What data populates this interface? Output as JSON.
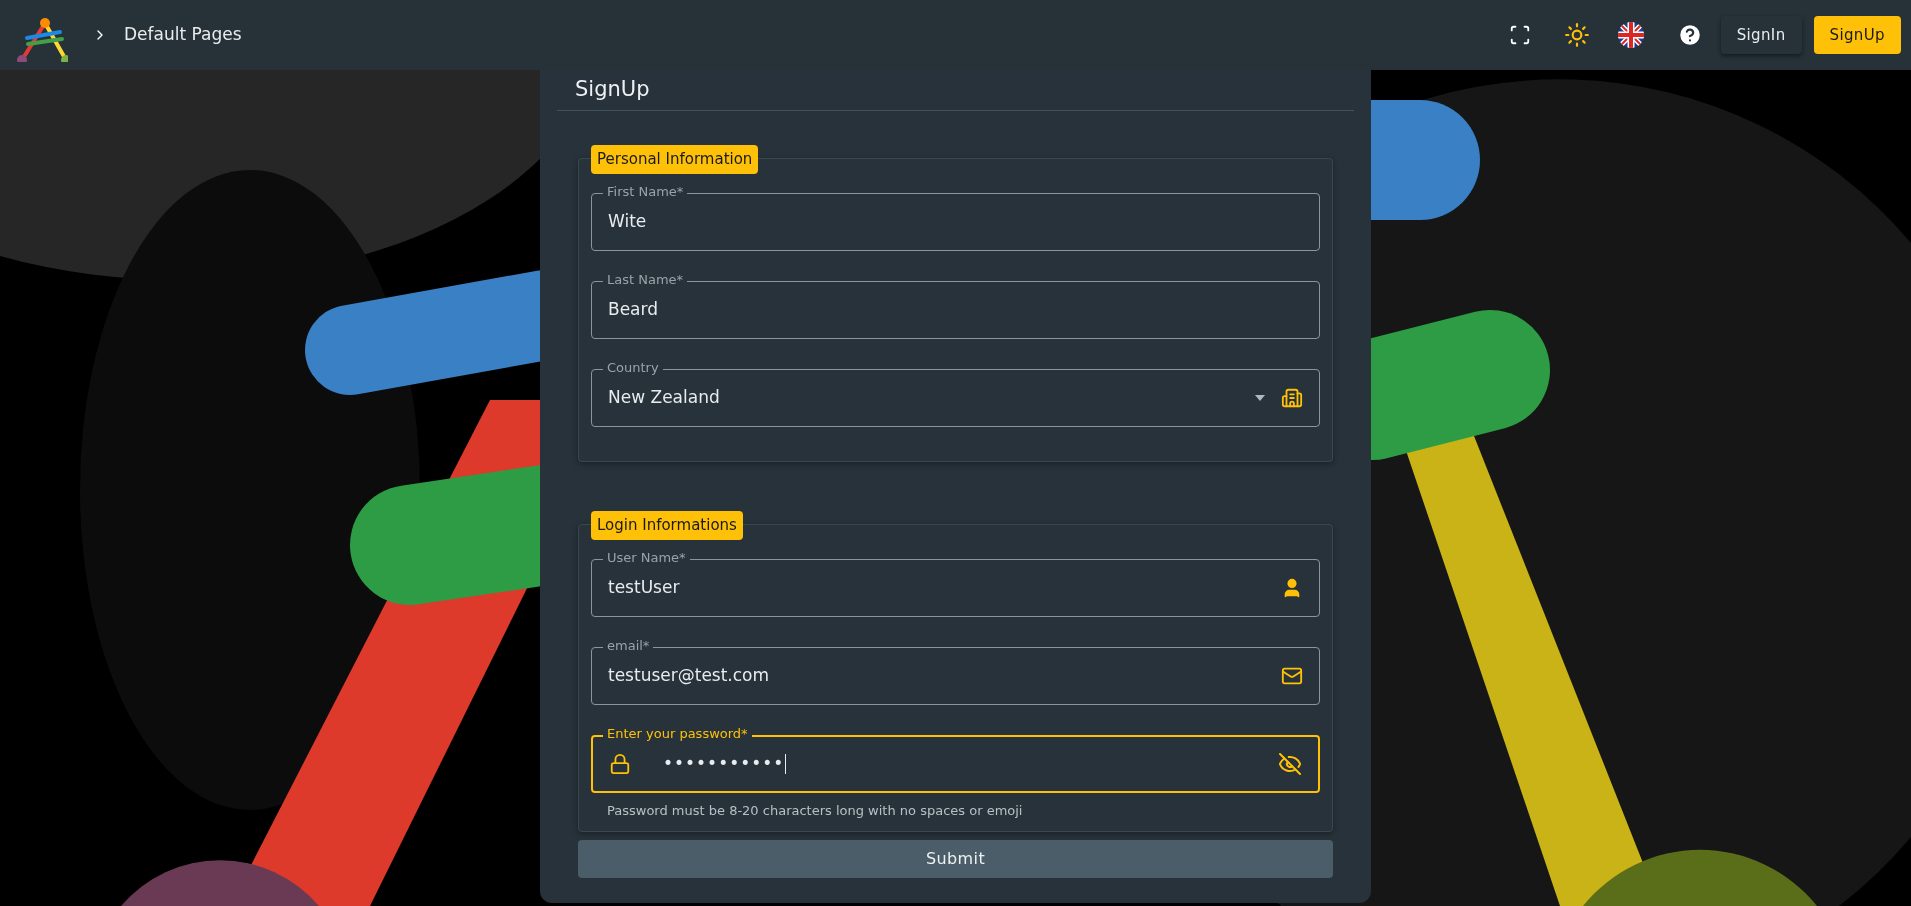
{
  "header": {
    "breadcrumb": "Default Pages",
    "buttons": [
      {
        "label": "SignIn",
        "kind": "plain"
      },
      {
        "label": "SignUp",
        "kind": "primary"
      }
    ]
  },
  "card": {
    "title": "SignUp",
    "sections": [
      {
        "legend": "Personal Information",
        "fields": [
          {
            "kind": "text",
            "label": "First Name*",
            "value": "Wite",
            "focused": false
          },
          {
            "kind": "text",
            "label": "Last Name*",
            "value": "Beard",
            "focused": false
          },
          {
            "kind": "select",
            "label": "Country",
            "value": "New Zealand",
            "focused": false
          }
        ]
      },
      {
        "legend": "Login Informations",
        "fields": [
          {
            "kind": "user",
            "label": "User Name*",
            "value": "testUser",
            "focused": false
          },
          {
            "kind": "email",
            "label": "email*",
            "value": "testuser@test.com",
            "focused": false
          },
          {
            "kind": "password",
            "label": "Enter your password*",
            "value": "•••••••••••",
            "focused": true,
            "helper": "Password must be 8-20 characters long with no spaces or emoji"
          }
        ]
      }
    ],
    "submit": "Submit"
  }
}
